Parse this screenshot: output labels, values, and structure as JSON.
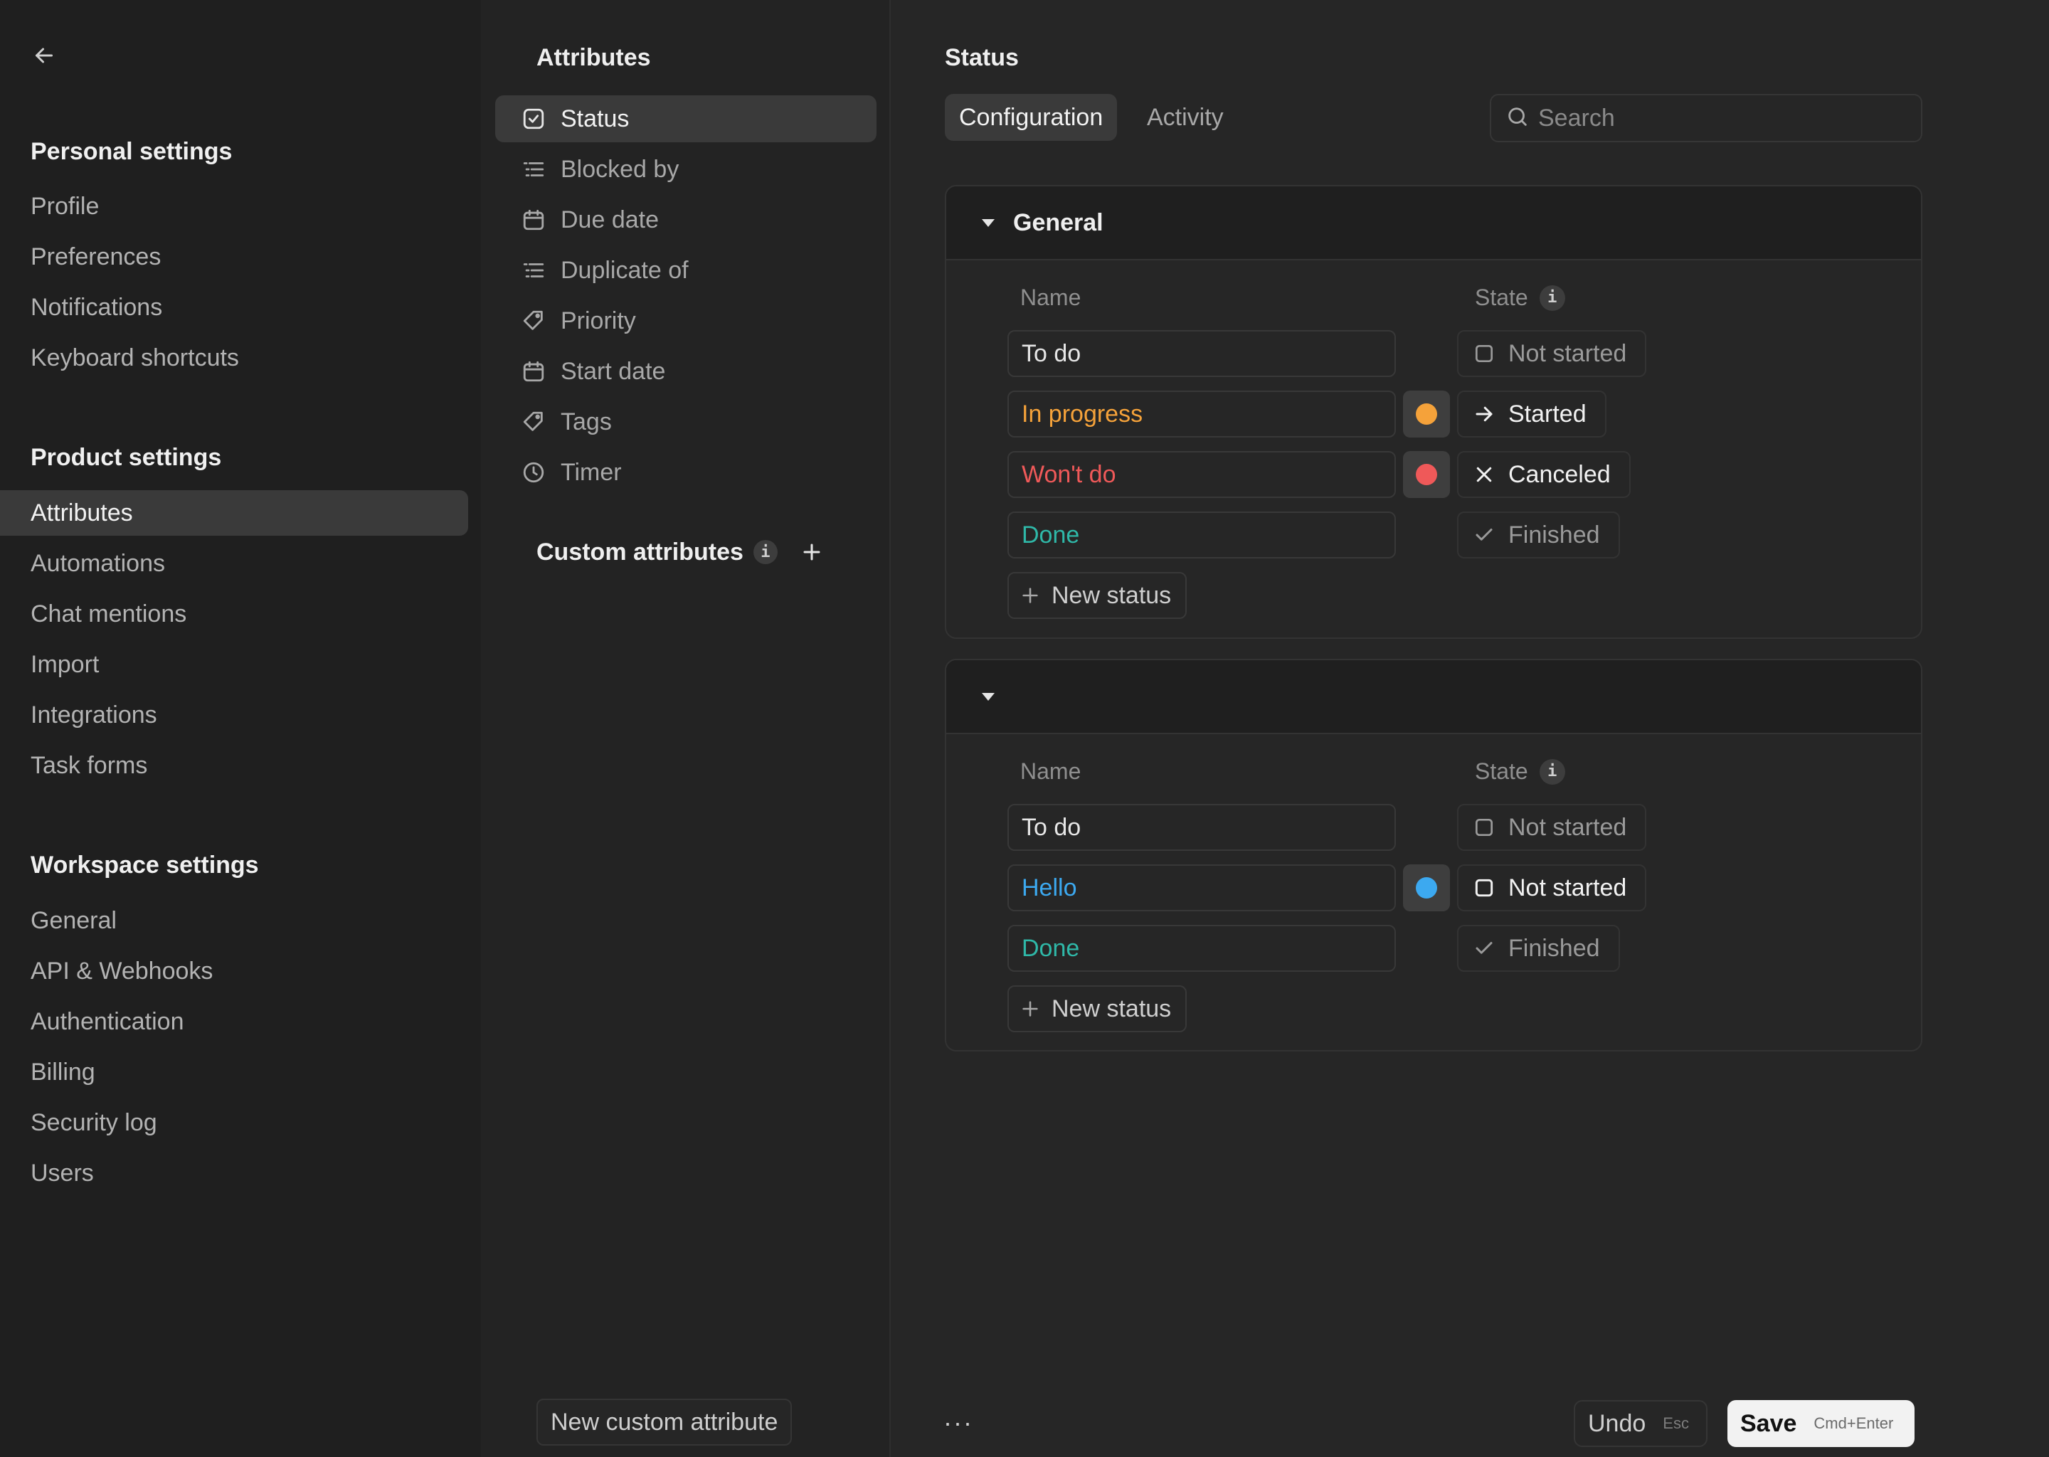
{
  "colors": {
    "orange": "#f5a23a",
    "red": "#ef5959",
    "teal": "#2fb8a8",
    "blue": "#3ca9f0"
  },
  "sidebar": {
    "back_icon": "arrow-left-icon",
    "personal_title": "Personal settings",
    "personal_items": [
      "Profile",
      "Preferences",
      "Notifications",
      "Keyboard shortcuts"
    ],
    "product_title": "Product settings",
    "product_items": [
      "Attributes",
      "Automations",
      "Chat mentions",
      "Import",
      "Integrations",
      "Task forms"
    ],
    "workspace_title": "Workspace settings",
    "workspace_items": [
      "General",
      "API & Webhooks",
      "Authentication",
      "Billing",
      "Security log",
      "Users"
    ]
  },
  "attributes": {
    "title": "Attributes",
    "items": [
      {
        "label": "Status",
        "icon": "checkbox-icon"
      },
      {
        "label": "Blocked by",
        "icon": "list-icon"
      },
      {
        "label": "Due date",
        "icon": "calendar-icon"
      },
      {
        "label": "Duplicate of",
        "icon": "list-icon"
      },
      {
        "label": "Priority",
        "icon": "tag-icon"
      },
      {
        "label": "Start date",
        "icon": "calendar-icon"
      },
      {
        "label": "Tags",
        "icon": "tag-icon"
      },
      {
        "label": "Timer",
        "icon": "clock-icon"
      }
    ],
    "custom_title": "Custom attributes",
    "info": "i",
    "new_custom": "New custom attribute"
  },
  "main": {
    "title": "Status",
    "tabs": [
      "Configuration",
      "Activity"
    ],
    "search_placeholder": "Search",
    "col_name": "Name",
    "col_state": "State",
    "info": "i",
    "new_status": "New status",
    "groups": [
      {
        "name": "General",
        "rows": [
          {
            "name": "To do",
            "state": "Not started"
          },
          {
            "name": "In progress",
            "state": "Started"
          },
          {
            "name": "Won't do",
            "state": "Canceled"
          },
          {
            "name": "Done",
            "state": "Finished"
          }
        ]
      },
      {
        "name": "",
        "rows": [
          {
            "name": "To do",
            "state": "Not started"
          },
          {
            "name": "Hello",
            "state": "Not started"
          },
          {
            "name": "Done",
            "state": "Finished"
          }
        ]
      }
    ],
    "more": "···",
    "undo": "Undo",
    "undo_key": "Esc",
    "save": "Save",
    "save_key": "Cmd+Enter"
  }
}
